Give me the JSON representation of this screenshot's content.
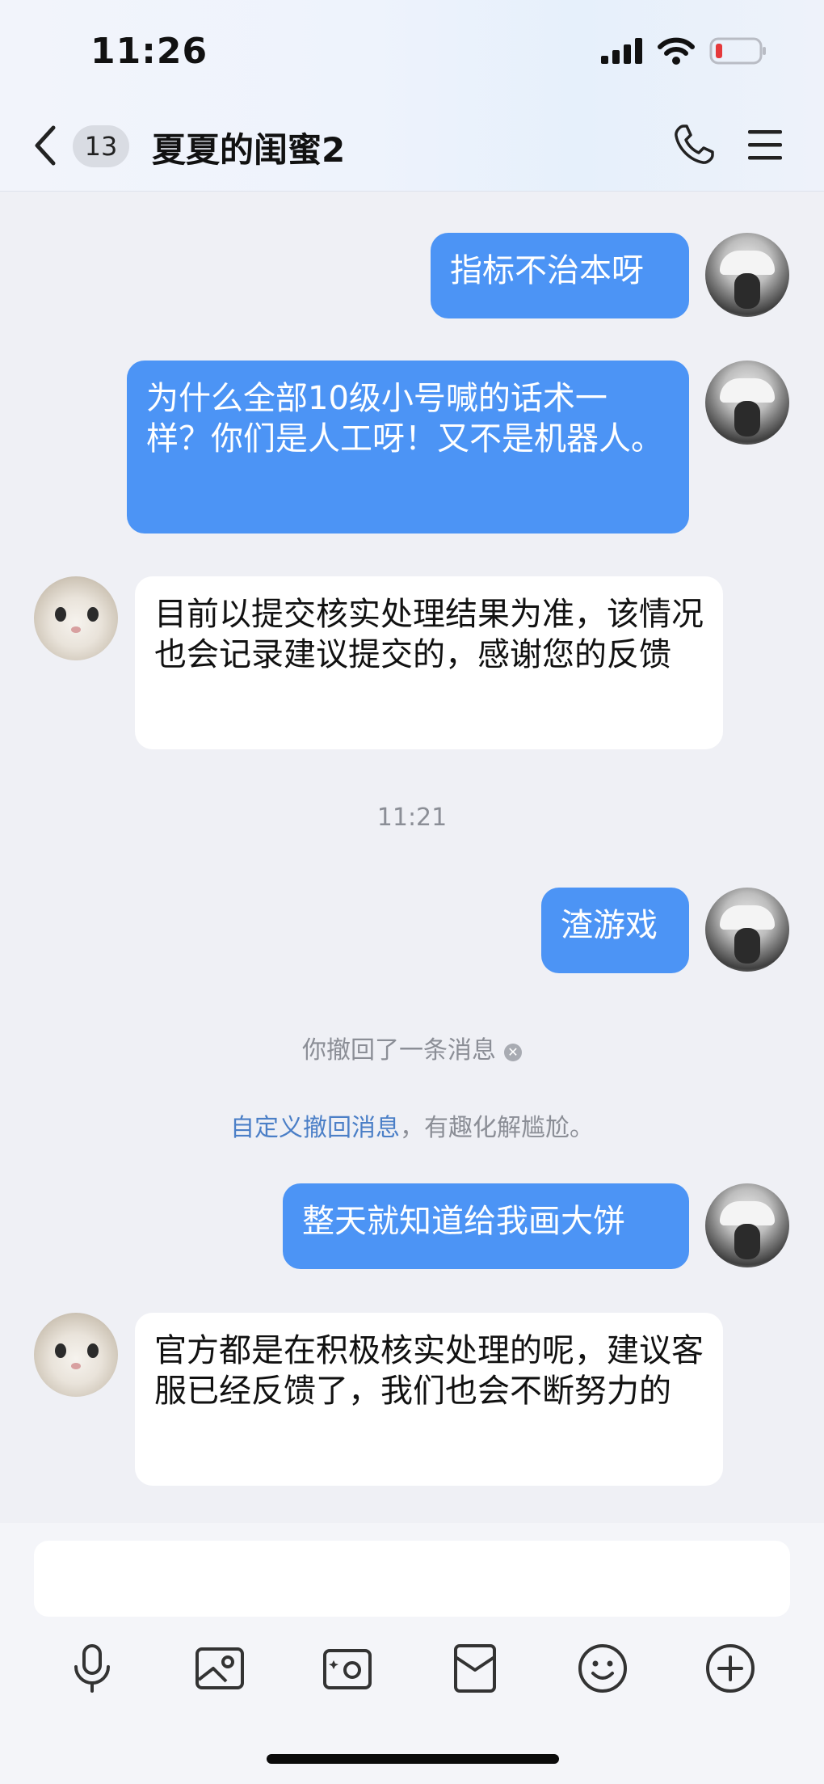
{
  "status": {
    "time": "11:26"
  },
  "header": {
    "unread_count": "13",
    "title": "夏夏的闺蜜2"
  },
  "messages": {
    "m1": "指标不治本呀",
    "m2": "为什么全部10级小号喊的话术一样？你们是人工呀！又不是机器人。",
    "m3": "目前以提交核实处理结果为准，该情况也会记录建议提交的，感谢您的反馈",
    "time_divider": "11:21",
    "m4": "渣游戏",
    "recall_notice": "你撤回了一条消息",
    "custom_recall_link": "自定义撤回消息",
    "custom_recall_suffix": "，有趣化解尴尬。",
    "m5": "整天就知道给我画大饼",
    "m6": "官方都是在积极核实处理的呢，建议客服已经反馈了，我们也会不断努力的"
  },
  "colors": {
    "outgoing_bubble": "#4c94f5",
    "incoming_bubble": "#ffffff",
    "background": "#eff0f5"
  },
  "icons": [
    "signal-icon",
    "wifi-icon",
    "battery-icon",
    "back-icon",
    "phone-icon",
    "menu-icon",
    "microphone-icon",
    "image-icon",
    "camera-icon",
    "red-packet-icon",
    "emoji-icon",
    "plus-icon"
  ]
}
